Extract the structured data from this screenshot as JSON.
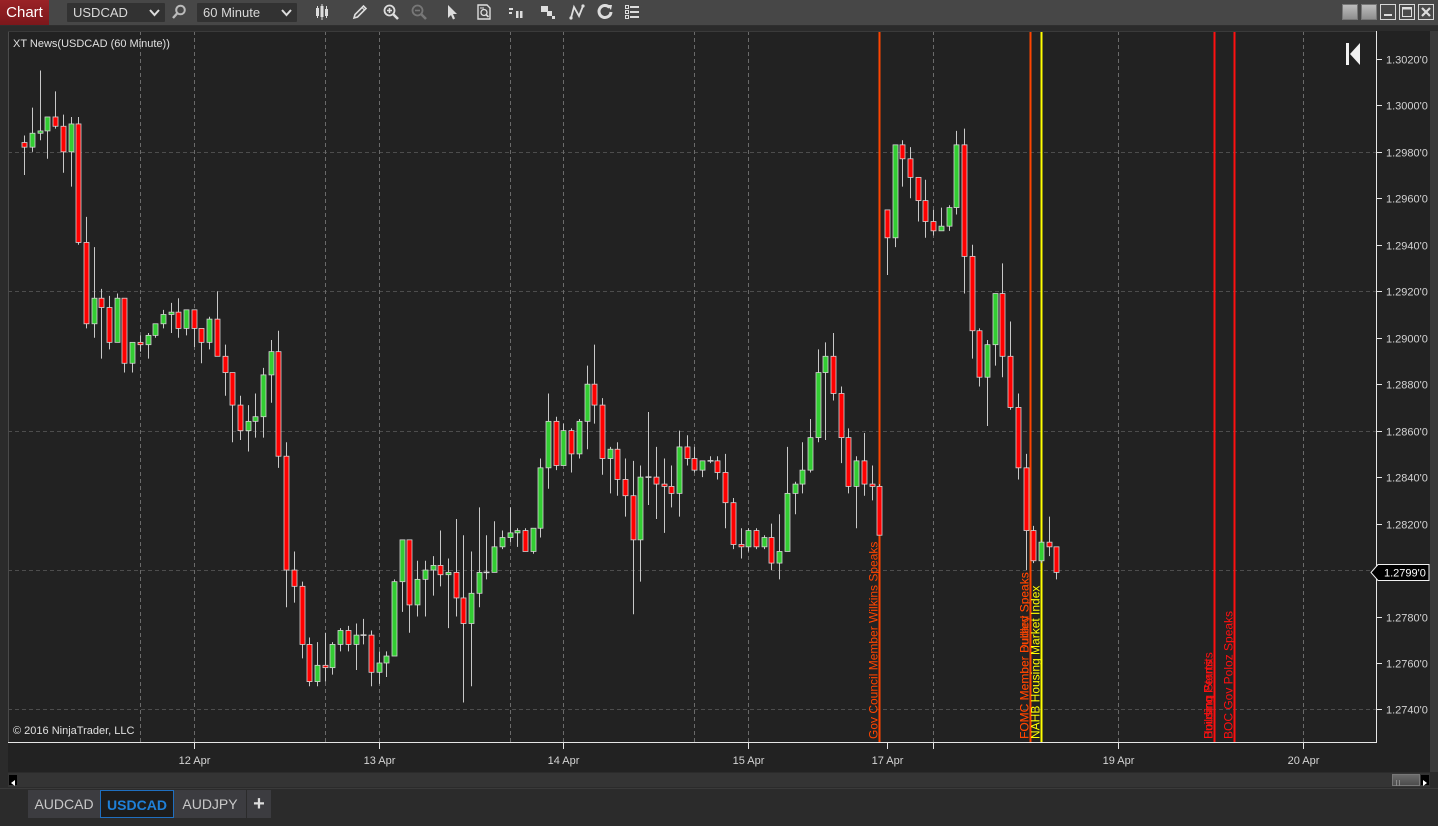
{
  "window": {
    "app_button": "Chart",
    "controls": [
      "link-instrument-square",
      "link-interval-square",
      "minimize",
      "maximize",
      "close"
    ]
  },
  "toolbar": {
    "instrument": "USDCAD",
    "interval": "60 Minute",
    "icons": [
      "chart-style",
      "drawing-tools-pencil",
      "zoom-in",
      "zoom-out",
      "pointer",
      "data-box",
      "indicators",
      "strategies",
      "draw-objects",
      "reload",
      "properties-list"
    ]
  },
  "chart": {
    "title": "XT News(USDCAD (60 Minute))",
    "copyright": "© 2016 NinjaTrader, LLC"
  },
  "scrollbar": {
    "position": 1.0
  },
  "tabs": [
    {
      "label": "AUDCAD",
      "active": false
    },
    {
      "label": "USDCAD",
      "active": true
    },
    {
      "label": "AUDJPY",
      "active": false
    }
  ],
  "add_tab": "+",
  "colors": {
    "up": "#32cd32",
    "down": "#ff0000",
    "wick": "#c8c8c8",
    "body_outline": "#d4d4d4",
    "active_tab": "#1f80d8",
    "app_button": "#8c1c1f"
  },
  "chart_data": {
    "type": "bar",
    "style": "candlestick",
    "title": "XT News(USDCAD (60 Minute))",
    "instrument": "USDCAD",
    "interval": "60 Minute",
    "ohlc_fields": [
      "open",
      "high",
      "low",
      "close"
    ],
    "ohlc": [
      [
        1.2984,
        1.2987,
        1.297,
        1.2982
      ],
      [
        1.2982,
        1.2999,
        1.298,
        1.2988
      ],
      [
        1.2988,
        1.3015,
        1.2985,
        1.2989
      ],
      [
        1.2989,
        1.2995,
        1.2977,
        1.2995
      ],
      [
        1.2995,
        1.3006,
        1.299,
        1.2991
      ],
      [
        1.2991,
        1.2996,
        1.2971,
        1.298
      ],
      [
        1.298,
        1.2995,
        1.2965,
        1.2992
      ],
      [
        1.2992,
        1.2995,
        1.294,
        1.2941
      ],
      [
        1.2941,
        1.2952,
        1.2904,
        1.2906
      ],
      [
        1.2906,
        1.2939,
        1.29,
        1.2917
      ],
      [
        1.2917,
        1.2921,
        1.2891,
        1.2913
      ],
      [
        1.2913,
        1.2918,
        1.2895,
        1.2898
      ],
      [
        1.2898,
        1.2919,
        1.2898,
        1.2917
      ],
      [
        1.2917,
        1.2917,
        1.2885,
        1.2889
      ],
      [
        1.2889,
        1.2898,
        1.2885,
        1.2898
      ],
      [
        1.2898,
        1.2901,
        1.2894,
        1.2897
      ],
      [
        1.2897,
        1.2902,
        1.2891,
        1.2901
      ],
      [
        1.2901,
        1.2906,
        1.29,
        1.2906
      ],
      [
        1.2906,
        1.2912,
        1.2904,
        1.291
      ],
      [
        1.291,
        1.2915,
        1.2902,
        1.2911
      ],
      [
        1.2911,
        1.2917,
        1.29,
        1.2904
      ],
      [
        1.2904,
        1.2912,
        1.2901,
        1.2912
      ],
      [
        1.2912,
        1.2912,
        1.2896,
        1.2904
      ],
      [
        1.2904,
        1.2904,
        1.2889,
        1.2898
      ],
      [
        1.2898,
        1.2909,
        1.2895,
        1.2908
      ],
      [
        1.2908,
        1.292,
        1.2892,
        1.2892
      ],
      [
        1.2892,
        1.2897,
        1.2875,
        1.2885
      ],
      [
        1.2885,
        1.2885,
        1.2855,
        1.2871
      ],
      [
        1.2871,
        1.2875,
        1.2856,
        1.286
      ],
      [
        1.286,
        1.2871,
        1.2851,
        1.2864
      ],
      [
        1.2864,
        1.2876,
        1.2857,
        1.2866
      ],
      [
        1.2866,
        1.2887,
        1.2857,
        1.2884
      ],
      [
        1.2884,
        1.2899,
        1.2872,
        1.2894
      ],
      [
        1.2894,
        1.2903,
        1.2844,
        1.2849
      ],
      [
        1.2849,
        1.2855,
        1.2784,
        1.28
      ],
      [
        1.28,
        1.2808,
        1.2786,
        1.2793
      ],
      [
        1.2793,
        1.2795,
        1.2762,
        1.2768
      ],
      [
        1.2768,
        1.2771,
        1.275,
        1.2752
      ],
      [
        1.2752,
        1.2769,
        1.275,
        1.2759
      ],
      [
        1.2759,
        1.2773,
        1.2752,
        1.2758
      ],
      [
        1.2758,
        1.2769,
        1.2755,
        1.2768
      ],
      [
        1.2768,
        1.2775,
        1.2765,
        1.2774
      ],
      [
        1.2774,
        1.2776,
        1.2765,
        1.2768
      ],
      [
        1.2768,
        1.2777,
        1.2757,
        1.2772
      ],
      [
        1.2772,
        1.2779,
        1.2768,
        1.2772
      ],
      [
        1.2772,
        1.2774,
        1.275,
        1.2756
      ],
      [
        1.2756,
        1.2765,
        1.2751,
        1.276
      ],
      [
        1.276,
        1.2765,
        1.2754,
        1.2763
      ],
      [
        1.2763,
        1.2796,
        1.2763,
        1.2795
      ],
      [
        1.2795,
        1.2813,
        1.2782,
        1.2813
      ],
      [
        1.2813,
        1.2813,
        1.2773,
        1.2785
      ],
      [
        1.2785,
        1.2804,
        1.278,
        1.2796
      ],
      [
        1.2796,
        1.2804,
        1.278,
        1.28
      ],
      [
        1.28,
        1.2806,
        1.2789,
        1.2802
      ],
      [
        1.2802,
        1.2817,
        1.2793,
        1.2798
      ],
      [
        1.2798,
        1.2805,
        1.2775,
        1.2799
      ],
      [
        1.2799,
        1.2822,
        1.278,
        1.2788
      ],
      [
        1.2788,
        1.2815,
        1.2743,
        1.2777
      ],
      [
        1.2777,
        1.2808,
        1.275,
        1.279
      ],
      [
        1.279,
        1.2827,
        1.2784,
        1.2799
      ],
      [
        1.2799,
        1.2815,
        1.2796,
        1.2799
      ],
      [
        1.2799,
        1.2821,
        1.2799,
        1.281
      ],
      [
        1.281,
        1.2817,
        1.2809,
        1.2814
      ],
      [
        1.2814,
        1.2827,
        1.2812,
        1.2816
      ],
      [
        1.2816,
        1.2818,
        1.281,
        1.2817
      ],
      [
        1.2817,
        1.2818,
        1.2808,
        1.2808
      ],
      [
        1.2808,
        1.2818,
        1.2807,
        1.2818
      ],
      [
        1.2818,
        1.2848,
        1.2814,
        1.2844
      ],
      [
        1.2844,
        1.2876,
        1.2835,
        1.2864
      ],
      [
        1.2864,
        1.2866,
        1.2843,
        1.2845
      ],
      [
        1.2845,
        1.2863,
        1.2845,
        1.286
      ],
      [
        1.286,
        1.2861,
        1.2842,
        1.285
      ],
      [
        1.285,
        1.2865,
        1.2848,
        1.2864
      ],
      [
        1.2864,
        1.2888,
        1.2852,
        1.288
      ],
      [
        1.288,
        1.2897,
        1.2863,
        1.2871
      ],
      [
        1.2871,
        1.2874,
        1.2841,
        1.2848
      ],
      [
        1.2848,
        1.2853,
        1.2833,
        1.2852
      ],
      [
        1.2852,
        1.2855,
        1.2832,
        1.2839
      ],
      [
        1.2839,
        1.2848,
        1.2823,
        1.2832
      ],
      [
        1.2832,
        1.2847,
        1.2781,
        1.2813
      ],
      [
        1.2813,
        1.2845,
        1.2795,
        1.284
      ],
      [
        1.284,
        1.2868,
        1.2828,
        1.284
      ],
      [
        1.284,
        1.2853,
        1.2822,
        1.2837
      ],
      [
        1.2837,
        1.2848,
        1.2816,
        1.2836
      ],
      [
        1.2836,
        1.2845,
        1.2827,
        1.2833
      ],
      [
        1.2833,
        1.286,
        1.2823,
        1.2853
      ],
      [
        1.2853,
        1.2858,
        1.2845,
        1.2848
      ],
      [
        1.2848,
        1.2853,
        1.2842,
        1.2843
      ],
      [
        1.2843,
        1.2847,
        1.284,
        1.2847
      ],
      [
        1.2847,
        1.2849,
        1.2846,
        1.2847
      ],
      [
        1.2847,
        1.2849,
        1.2839,
        1.2842
      ],
      [
        1.2842,
        1.285,
        1.2818,
        1.2829
      ],
      [
        1.2829,
        1.2831,
        1.2809,
        1.2811
      ],
      [
        1.2811,
        1.2818,
        1.2805,
        1.281
      ],
      [
        1.281,
        1.2818,
        1.2808,
        1.2817
      ],
      [
        1.2817,
        1.2818,
        1.2809,
        1.281
      ],
      [
        1.281,
        1.2815,
        1.2809,
        1.2814
      ],
      [
        1.2814,
        1.282,
        1.28,
        1.2803
      ],
      [
        1.2803,
        1.2824,
        1.2796,
        1.2808
      ],
      [
        1.2808,
        1.2853,
        1.2808,
        1.2833
      ],
      [
        1.2833,
        1.2838,
        1.2824,
        1.2837
      ],
      [
        1.2837,
        1.2855,
        1.2833,
        1.2843
      ],
      [
        1.2843,
        1.2865,
        1.2842,
        1.2857
      ],
      [
        1.2857,
        1.2895,
        1.2855,
        1.2885
      ],
      [
        1.2885,
        1.2898,
        1.2856,
        1.2892
      ],
      [
        1.2892,
        1.2902,
        1.2873,
        1.2876
      ],
      [
        1.2876,
        1.2879,
        1.2846,
        1.2857
      ],
      [
        1.2857,
        1.2861,
        1.2833,
        1.2836
      ],
      [
        1.2836,
        1.2849,
        1.2818,
        1.2847
      ],
      [
        1.2847,
        1.2859,
        1.2832,
        1.2837
      ],
      [
        1.2837,
        1.2845,
        1.283,
        1.2836
      ],
      [
        1.2836,
        1.2837,
        1.2815,
        1.2815
      ],
      [
        1.2955,
        1.2955,
        1.2927,
        1.2943
      ],
      [
        1.2943,
        1.2983,
        1.2939,
        1.2983
      ],
      [
        1.2983,
        1.2985,
        1.2965,
        1.2977
      ],
      [
        1.2977,
        1.2982,
        1.296,
        1.2969
      ],
      [
        1.2969,
        1.2969,
        1.295,
        1.2959
      ],
      [
        1.2959,
        1.2968,
        1.2943,
        1.295
      ],
      [
        1.295,
        1.2955,
        1.2944,
        1.2946
      ],
      [
        1.2946,
        1.2956,
        1.2946,
        1.2948
      ],
      [
        1.2948,
        1.2957,
        1.2946,
        1.2956
      ],
      [
        1.2956,
        1.2989,
        1.2953,
        1.2983
      ],
      [
        1.2983,
        1.299,
        1.2919,
        1.2935
      ],
      [
        1.2935,
        1.294,
        1.2891,
        1.2903
      ],
      [
        1.2903,
        1.2904,
        1.2879,
        1.2883
      ],
      [
        1.2883,
        1.2899,
        1.2862,
        1.2897
      ],
      [
        1.2897,
        1.2919,
        1.2888,
        1.2919
      ],
      [
        1.2919,
        1.2932,
        1.2883,
        1.2892
      ],
      [
        1.2892,
        1.2907,
        1.2869,
        1.287
      ],
      [
        1.287,
        1.2876,
        1.2839,
        1.2844
      ],
      [
        1.2844,
        1.285,
        1.28,
        1.2817
      ],
      [
        1.2817,
        1.2819,
        1.2803,
        1.2804
      ],
      [
        1.2804,
        1.2813,
        1.2803,
        1.2812
      ],
      [
        1.2812,
        1.2823,
        1.2806,
        1.281
      ],
      [
        1.281,
        1.281,
        1.2796,
        1.2799
      ]
    ],
    "xaxis": {
      "unit": "bar index",
      "range": [
        -1.12,
        176.5
      ],
      "ticks": [
        {
          "bar": 23,
          "label": "12 Apr"
        },
        {
          "bar": 47,
          "label": "13 Apr"
        },
        {
          "bar": 71,
          "label": "14 Apr"
        },
        {
          "bar": 95,
          "label": "15 Apr"
        },
        {
          "bar": 113,
          "label": "17 Apr"
        },
        {
          "bar": 119,
          "label": ""
        },
        {
          "bar": 143,
          "label": "19 Apr"
        },
        {
          "bar": 167,
          "label": "20 Apr"
        }
      ],
      "gridlines": [
        16,
        23,
        40,
        47,
        64,
        71,
        88,
        95,
        119,
        143,
        167
      ]
    },
    "yaxis": {
      "range": [
        1.2726,
        1.3032
      ],
      "ticks": [
        {
          "value": 1.302,
          "label": "1.3020'0"
        },
        {
          "value": 1.3,
          "label": "1.3000'0"
        },
        {
          "value": 1.298,
          "label": "1.2980'0"
        },
        {
          "value": 1.296,
          "label": "1.2960'0"
        },
        {
          "value": 1.294,
          "label": "1.2940'0"
        },
        {
          "value": 1.292,
          "label": "1.2920'0"
        },
        {
          "value": 1.29,
          "label": "1.2900'0"
        },
        {
          "value": 1.288,
          "label": "1.2880'0"
        },
        {
          "value": 1.286,
          "label": "1.2860'0"
        },
        {
          "value": 1.284,
          "label": "1.2840'0"
        },
        {
          "value": 1.282,
          "label": "1.2820'0"
        },
        {
          "value": 1.278,
          "label": "1.2780'0"
        },
        {
          "value": 1.276,
          "label": "1.2760'0"
        },
        {
          "value": 1.274,
          "label": "1.2740'0"
        }
      ],
      "gridlines": [
        1.298,
        1.292,
        1.286,
        1.28,
        1.274
      ]
    },
    "current_price": {
      "value": 1.2799,
      "label": "1.2799'0"
    },
    "events": [
      {
        "bar": 111.98,
        "color": "#ff4500",
        "labels": [
          "Gov Council Member Wilkins Speaks"
        ]
      },
      {
        "bar": 131.58,
        "color": "#ff4500",
        "labels": [
          "FOMC Member Dudley Speaks",
          "FOMC Member Bullard Speaks"
        ]
      },
      {
        "bar": 133.0,
        "color": "#ffff00",
        "labels": [
          "NAHB Housing Market Index"
        ]
      },
      {
        "bar": 155.47,
        "color": "#ff1010",
        "labels": [
          "Building Permits",
          "Housing Starts"
        ]
      },
      {
        "bar": 158.06,
        "color": "#ff1010",
        "labels": [
          "BOC Gov Poloz Speaks"
        ]
      }
    ],
    "grid": true,
    "legend": "none"
  }
}
